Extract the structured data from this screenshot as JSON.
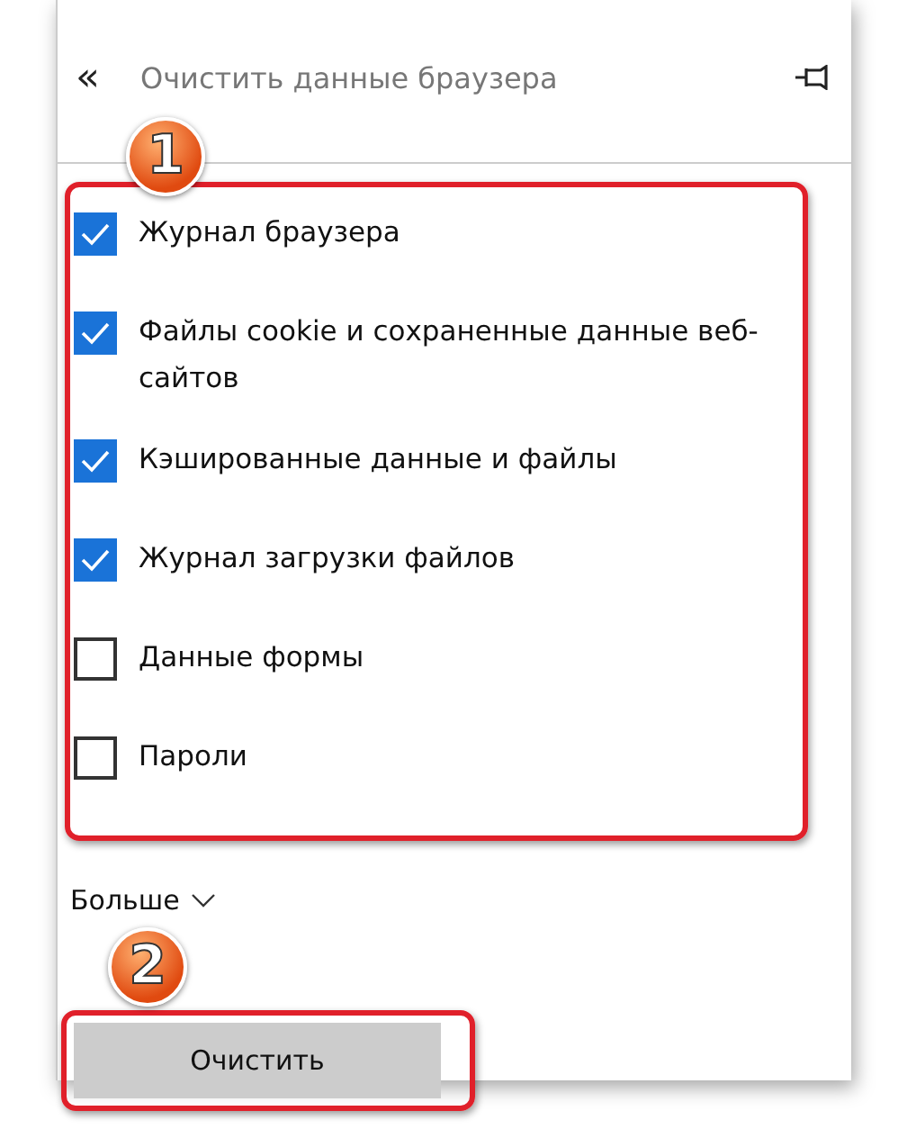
{
  "header": {
    "back": "«",
    "title": "Очистить данные браузера"
  },
  "callouts": [
    "1",
    "2"
  ],
  "options": [
    {
      "label": "Журнал браузера",
      "checked": true
    },
    {
      "label": "Файлы cookie и сохраненные данные веб-сайтов",
      "checked": true
    },
    {
      "label": "Кэшированные данные и файлы",
      "checked": true
    },
    {
      "label": "Журнал загрузки файлов",
      "checked": true
    },
    {
      "label": "Данные формы",
      "checked": false
    },
    {
      "label": "Пароли",
      "checked": false
    }
  ],
  "more": {
    "label": "Больше"
  },
  "clear_button": {
    "label": "Очистить"
  }
}
